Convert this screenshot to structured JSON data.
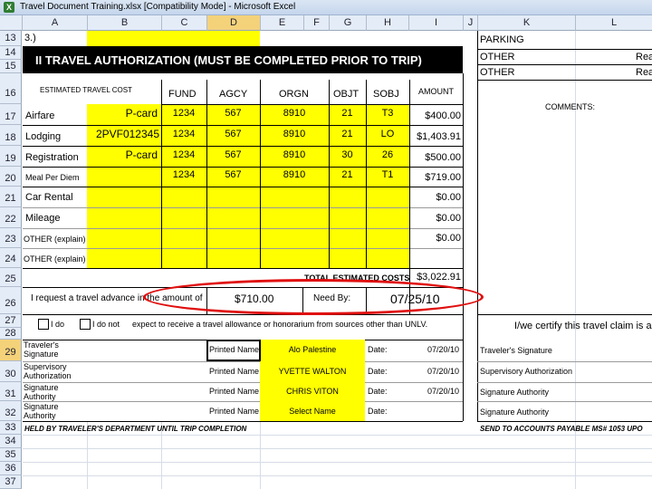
{
  "window": {
    "title": "Travel Document Training.xlsx  [Compatibility Mode] - Microsoft Excel",
    "icon": "excel-icon"
  },
  "columns": [
    "A",
    "B",
    "C",
    "D",
    "E",
    "F",
    "G",
    "H",
    "I",
    "J",
    "K",
    "L"
  ],
  "rows": [
    "13",
    "14",
    "15",
    "16",
    "17",
    "18",
    "19",
    "20",
    "21",
    "22",
    "23",
    "24",
    "25",
    "26",
    "27",
    "28",
    "29",
    "30",
    "31",
    "32",
    "33",
    "34",
    "35",
    "36",
    "37"
  ],
  "sheet": {
    "row13_text": "3.)",
    "section_title": "II   TRAVEL AUTHORIZATION (MUST BE COMPLETED PRIOR TO TRIP)",
    "estimated_header": "ESTIMATED TRAVEL COST",
    "headers": [
      "FUND",
      "AGCY",
      "ORGN",
      "OBJT",
      "SOBJ",
      "AMOUNT"
    ],
    "lines": [
      {
        "label": "Airfare",
        "method": "P-card",
        "fund": "1234",
        "agcy": "567",
        "orgn": "8910",
        "objt": "21",
        "sobj": "T3",
        "amount": "$400.00"
      },
      {
        "label": "Lodging",
        "method": "2PVF012345",
        "fund": "1234",
        "agcy": "567",
        "orgn": "8910",
        "objt": "21",
        "sobj": "LO",
        "amount": "$1,403.91"
      },
      {
        "label": "Registration",
        "method": "P-card",
        "fund": "1234",
        "agcy": "567",
        "orgn": "8910",
        "objt": "30",
        "sobj": "26",
        "amount": "$500.00"
      },
      {
        "label": "Meal Per Diem",
        "method": "",
        "fund": "1234",
        "agcy": "567",
        "orgn": "8910",
        "objt": "21",
        "sobj": "T1",
        "amount": "$719.00"
      },
      {
        "label": "Car Rental",
        "method": "",
        "fund": "",
        "agcy": "",
        "orgn": "",
        "objt": "",
        "sobj": "",
        "amount": "$0.00"
      },
      {
        "label": "Mileage",
        "method": "",
        "fund": "",
        "agcy": "",
        "orgn": "",
        "objt": "",
        "sobj": "",
        "amount": "$0.00"
      },
      {
        "label": "OTHER (explain)",
        "method": "",
        "fund": "",
        "agcy": "",
        "orgn": "",
        "objt": "",
        "sobj": "",
        "amount": "$0.00"
      },
      {
        "label": "OTHER (explain)",
        "method": "",
        "fund": "",
        "agcy": "",
        "orgn": "",
        "objt": "",
        "sobj": "",
        "amount": ""
      }
    ],
    "total_label": "TOTAL ESTIMATED COSTS",
    "total_value": "$3,022.91",
    "advance_label": "I request a travel advance in the amount of",
    "advance_value": "$710.00",
    "need_by_label": "Need By:",
    "need_by_value": "07/25/10",
    "row28_do": "I do",
    "row28_donot": "I do not",
    "row28_text": "expect to receive a travel allowance or honorarium from sources other than UNLV.",
    "signatures": [
      {
        "label": "Traveler's Signature",
        "printed_label": "Printed Name",
        "printed_value": "Alo Palestine",
        "date_label": "Date:",
        "date_value": "07/20/10"
      },
      {
        "label": "Supervisory Authorization",
        "printed_label": "Printed Name",
        "printed_value": "YVETTE WALTON",
        "date_label": "Date:",
        "date_value": "07/20/10"
      },
      {
        "label": "Signature Authority",
        "printed_label": "Printed Name",
        "printed_value": "CHRIS VITON",
        "date_label": "Date:",
        "date_value": "07/20/10"
      },
      {
        "label": "Signature Authority",
        "printed_label": "Printed Name",
        "printed_value": "Select Name",
        "date_label": "Date:",
        "date_value": ""
      }
    ],
    "held_note": "HELD BY TRAVELER'S DEPARTMENT UNTIL TRIP COMPLETION",
    "right_panel": {
      "parking": "PARKING",
      "other1": "OTHER",
      "other1_reason": "Rea",
      "other2": "OTHER",
      "other2_reason": "Rea",
      "comments": "COMMENTS:",
      "certify": "I/we certify this travel claim is acc",
      "sig1": "Traveler's Signature",
      "sig2": "Supervisory Authorization",
      "sig3": "Signature Authority",
      "sig4": "Signature Authority",
      "send_note": "SEND TO ACCOUNTS PAYABLE MS# 1053 UPO"
    }
  }
}
